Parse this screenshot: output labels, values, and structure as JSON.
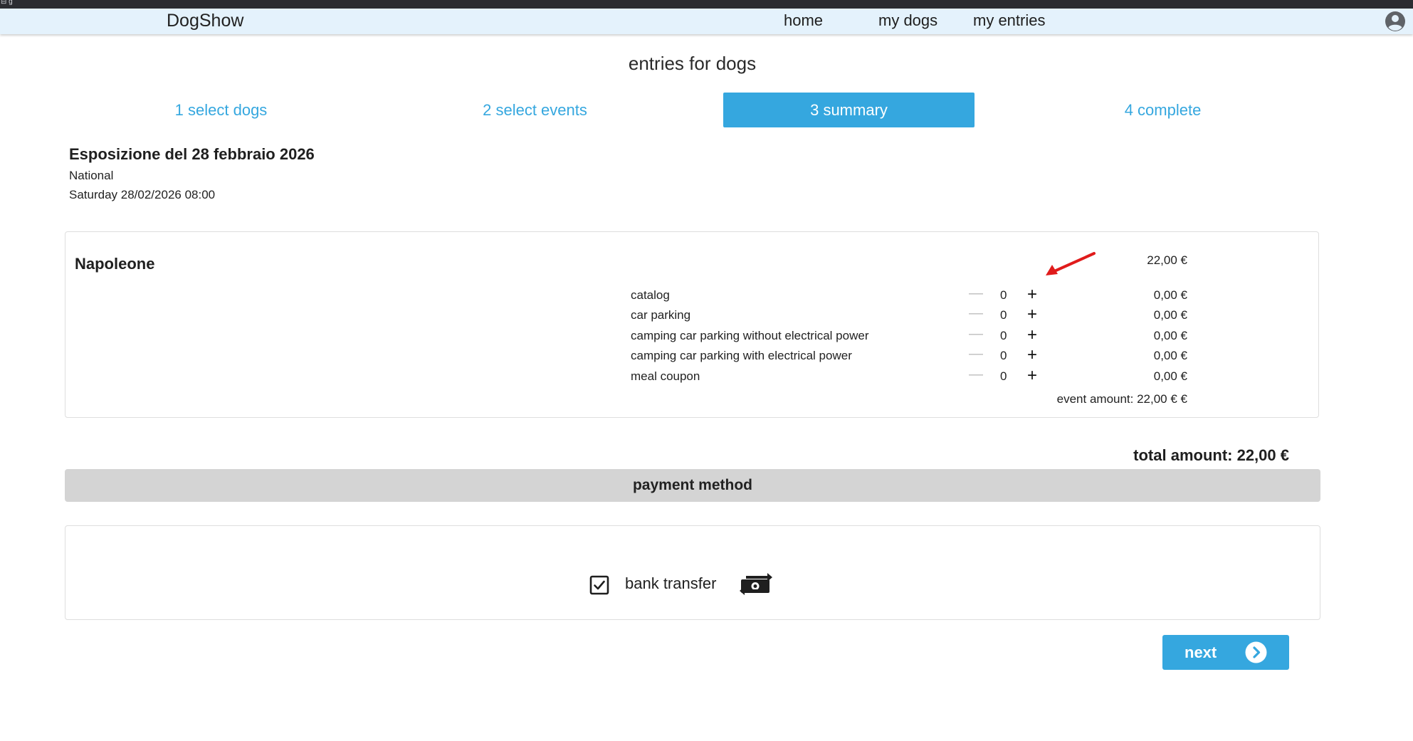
{
  "window": {
    "corner_glyph": "⊟ g"
  },
  "nav": {
    "brand": "DogShow",
    "links": [
      "home",
      "my dogs",
      "my entries"
    ]
  },
  "page": {
    "title": "entries for dogs"
  },
  "steps": [
    {
      "label": "1 select dogs",
      "active": false
    },
    {
      "label": "2 select events",
      "active": false
    },
    {
      "label": "3 summary",
      "active": true
    },
    {
      "label": "4 complete",
      "active": false
    }
  ],
  "event": {
    "title": "Esposizione del 28 febbraio 2026",
    "type": "National",
    "date": "Saturday 28/02/2026 08:00"
  },
  "dog": {
    "name": "Napoleone",
    "price": "22,00 €",
    "options": [
      {
        "label": "catalog",
        "minus": "—",
        "qty": "0",
        "plus": "+",
        "price": "0,00 €"
      },
      {
        "label": "car parking",
        "minus": "—",
        "qty": "0",
        "plus": "+",
        "price": "0,00 €"
      },
      {
        "label": "camping car parking without electrical power",
        "minus": "—",
        "qty": "0",
        "plus": "+",
        "price": "0,00 €"
      },
      {
        "label": "camping car parking with electrical power",
        "minus": "—",
        "qty": "0",
        "plus": "+",
        "price": "0,00 €"
      },
      {
        "label": "meal coupon",
        "minus": "—",
        "qty": "0",
        "plus": "+",
        "price": "0,00 €"
      }
    ],
    "event_amount": "event amount: 22,00 € €"
  },
  "total": "total amount: 22,00 €",
  "payment": {
    "header": "payment method",
    "method_label": "bank transfer",
    "checked": true
  },
  "next": {
    "label": "next"
  },
  "colors": {
    "accent": "#35a7df",
    "nav_bg": "#e4f2fc",
    "annotation_arrow": "#e01b1b"
  },
  "icons": {
    "account": "account-circle-icon",
    "checkbox": "checkbox-checked-icon",
    "payment": "money-transfer-icon",
    "next": "chevron-right-circle-icon",
    "annotation": "red-arrow-icon"
  }
}
